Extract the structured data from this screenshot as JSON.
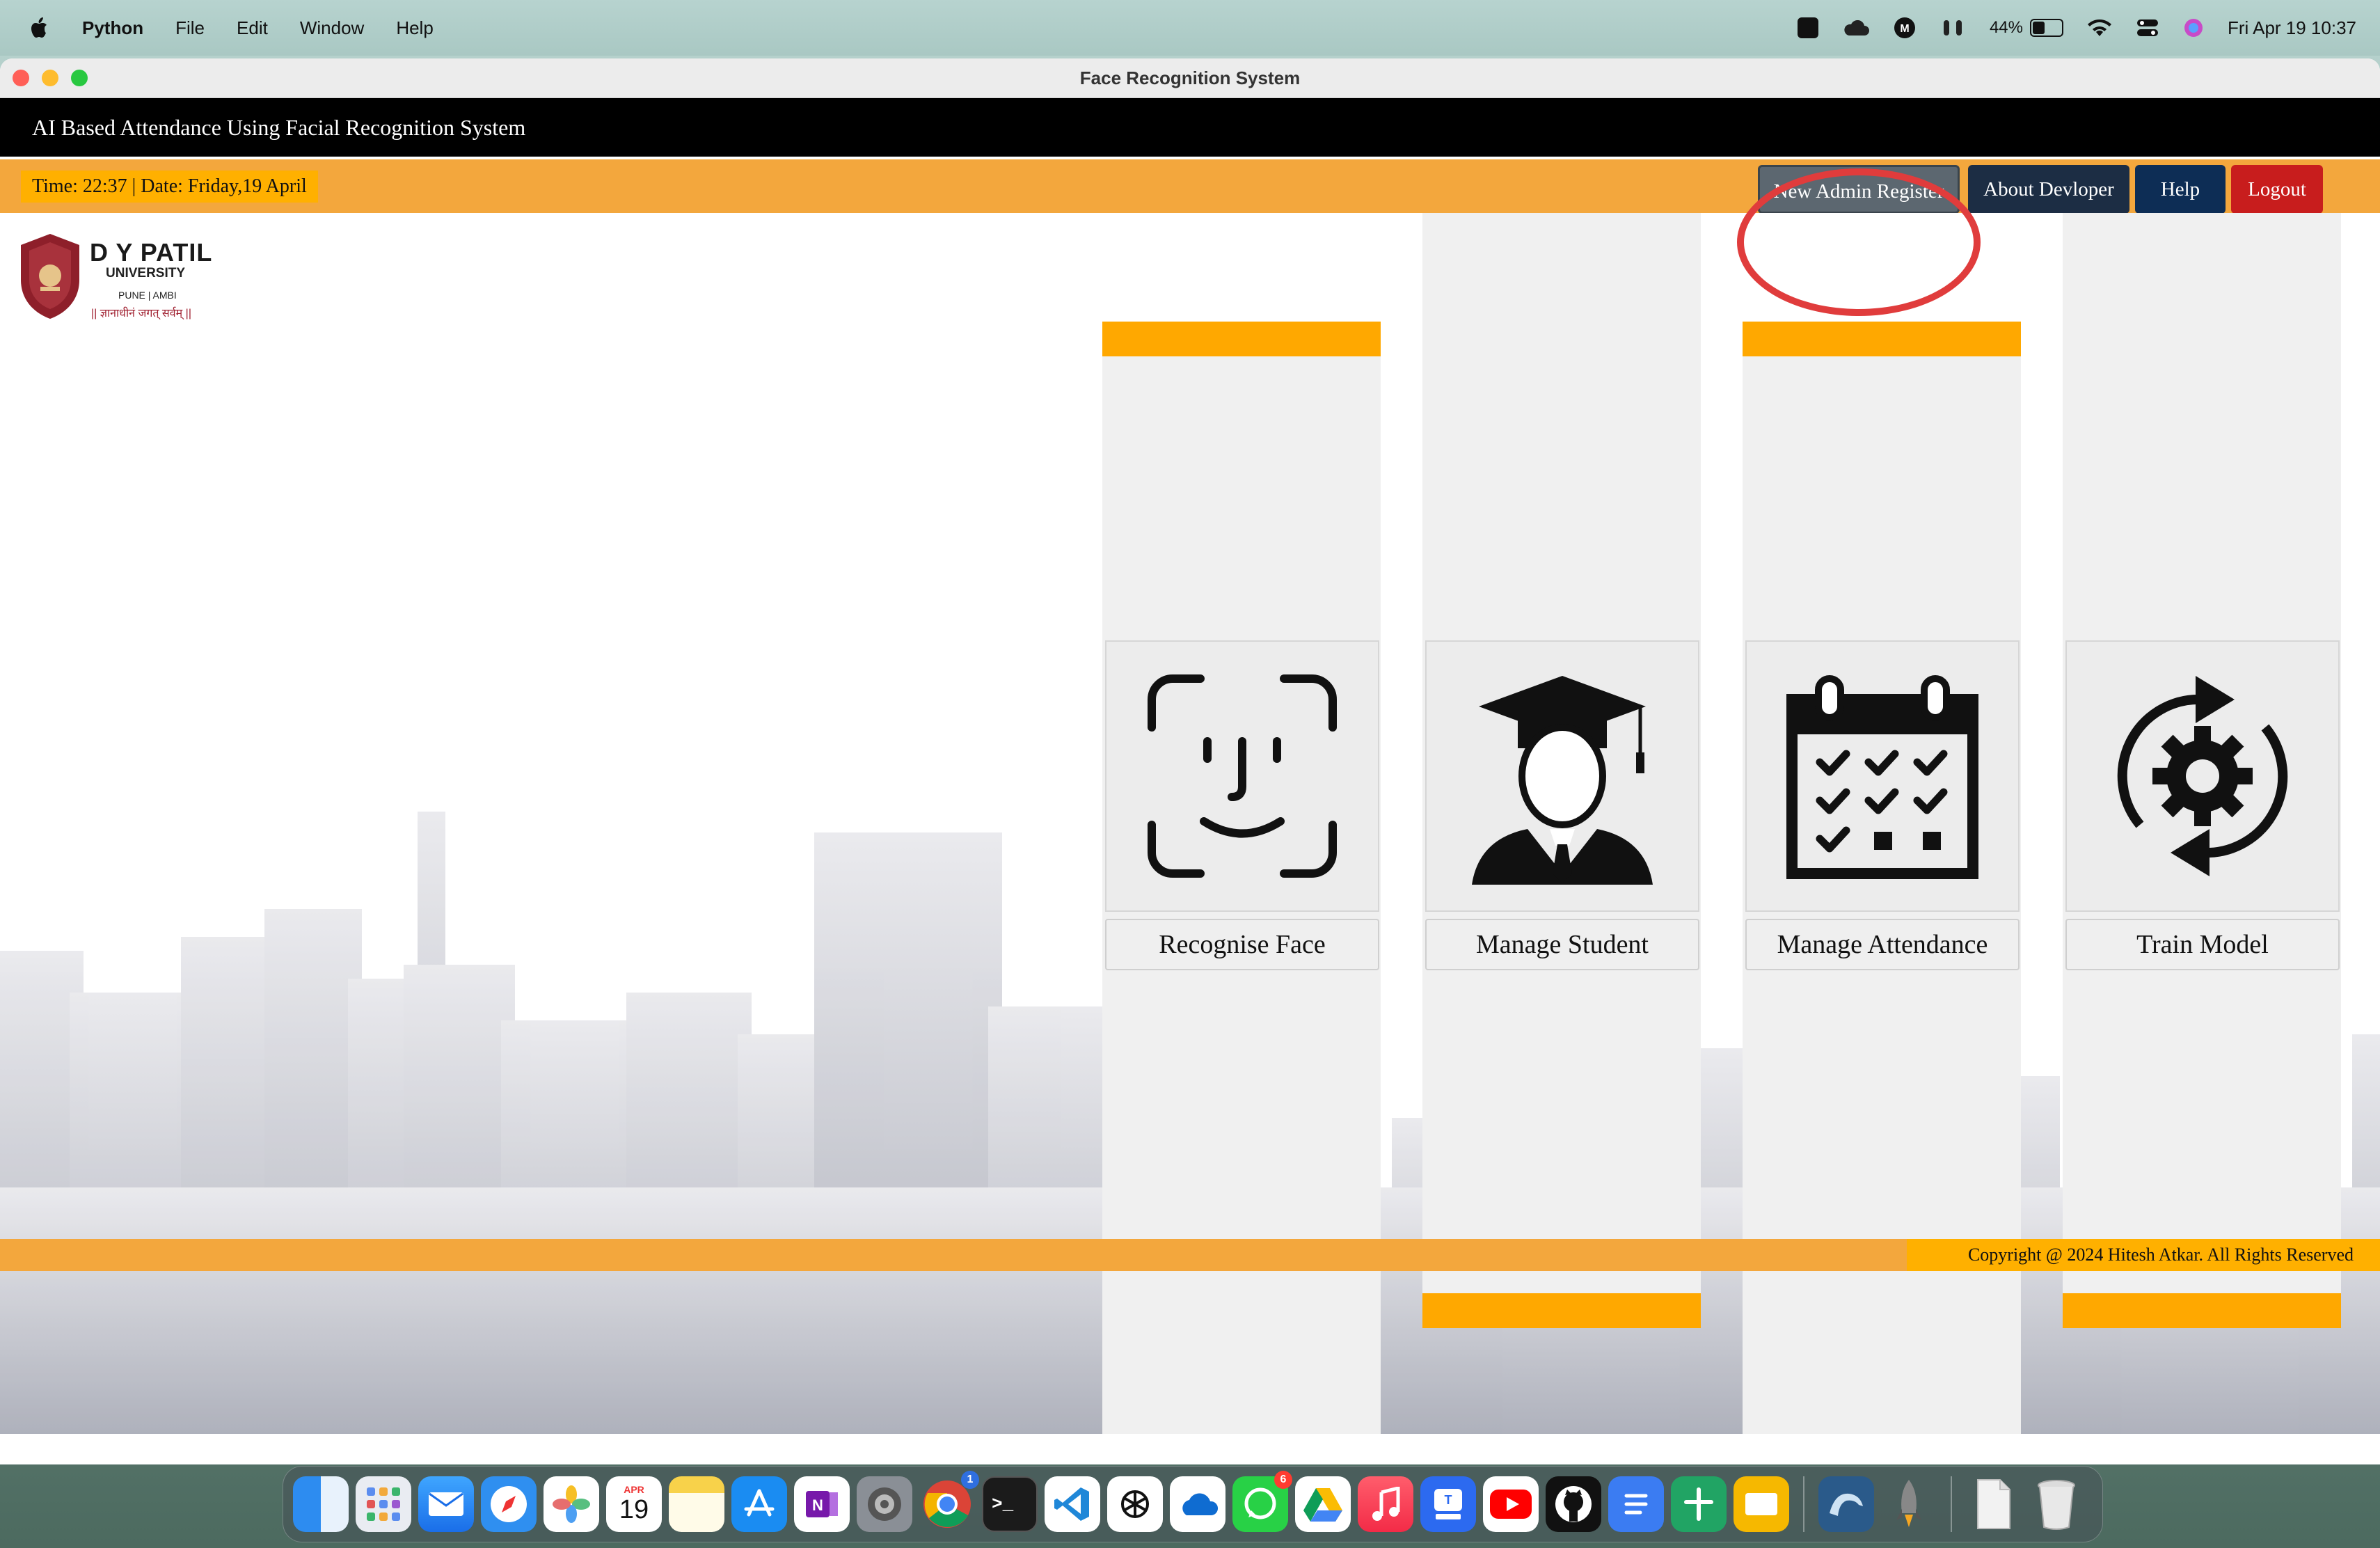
{
  "menubar": {
    "app_name": "Python",
    "items": [
      "File",
      "Edit",
      "Window",
      "Help"
    ],
    "battery_percent": "44%",
    "battery_level": 0.44,
    "datetime": "Fri Apr 19  10:37",
    "status_icons": [
      "drive-icon",
      "cloud-icon",
      "malwarebytes-icon",
      "airpods-icon",
      "battery-icon",
      "wifi-icon",
      "control-center-icon",
      "siri-icon"
    ]
  },
  "window": {
    "title": "Face Recognition System"
  },
  "app": {
    "header_title": "AI Based Attendance Using Facial Recognition System",
    "clock_text": "Time: 22:37 | Date: Friday,19 April",
    "buttons": {
      "new_admin": "New Admin Register",
      "about": "About Devloper",
      "help": "Help",
      "logout": "Logout"
    },
    "logo": {
      "name": "D Y PATIL",
      "university": "UNIVERSITY",
      "location": "PUNE | AMBI",
      "motto": "|| ज्ञानाधीनं जगत् सर्वम् ||"
    },
    "tiles": [
      {
        "label": "Recognise Face",
        "icon": "face-id-icon"
      },
      {
        "label": "Manage Student",
        "icon": "graduate-icon"
      },
      {
        "label": "Manage Attendance",
        "icon": "calendar-check-icon"
      },
      {
        "label": "Train Model",
        "icon": "gear-cycle-icon"
      }
    ],
    "footer": "Copyright @ 2024 Hitesh Atkar. All Rights Reserved"
  },
  "dock": {
    "calendar_month": "APR",
    "calendar_day": "19",
    "whatsapp_badge": "6",
    "chrome_badge": "1",
    "apps": [
      "finder-icon",
      "launchpad-icon",
      "mail-icon",
      "safari-icon",
      "photos-icon",
      "calendar-icon",
      "notes-icon",
      "app-store-icon",
      "onenote-icon",
      "system-settings-icon",
      "chrome-icon",
      "terminal-icon",
      "vscode-icon",
      "chatgpt-icon",
      "onedrive-icon",
      "whatsapp-icon",
      "google-drive-icon",
      "music-icon",
      "storage-icon",
      "youtube-icon",
      "github-icon",
      "docs-icon",
      "sheets-icon",
      "slides-icon",
      "mysql-workbench-icon",
      "rocket-icon",
      "document-icon",
      "trash-icon"
    ]
  },
  "colors": {
    "accent_orange": "#ffa800",
    "toolbar_orange": "#f3a73d",
    "logout_red": "#c81d1d",
    "highlight_red": "#e03c3c"
  }
}
